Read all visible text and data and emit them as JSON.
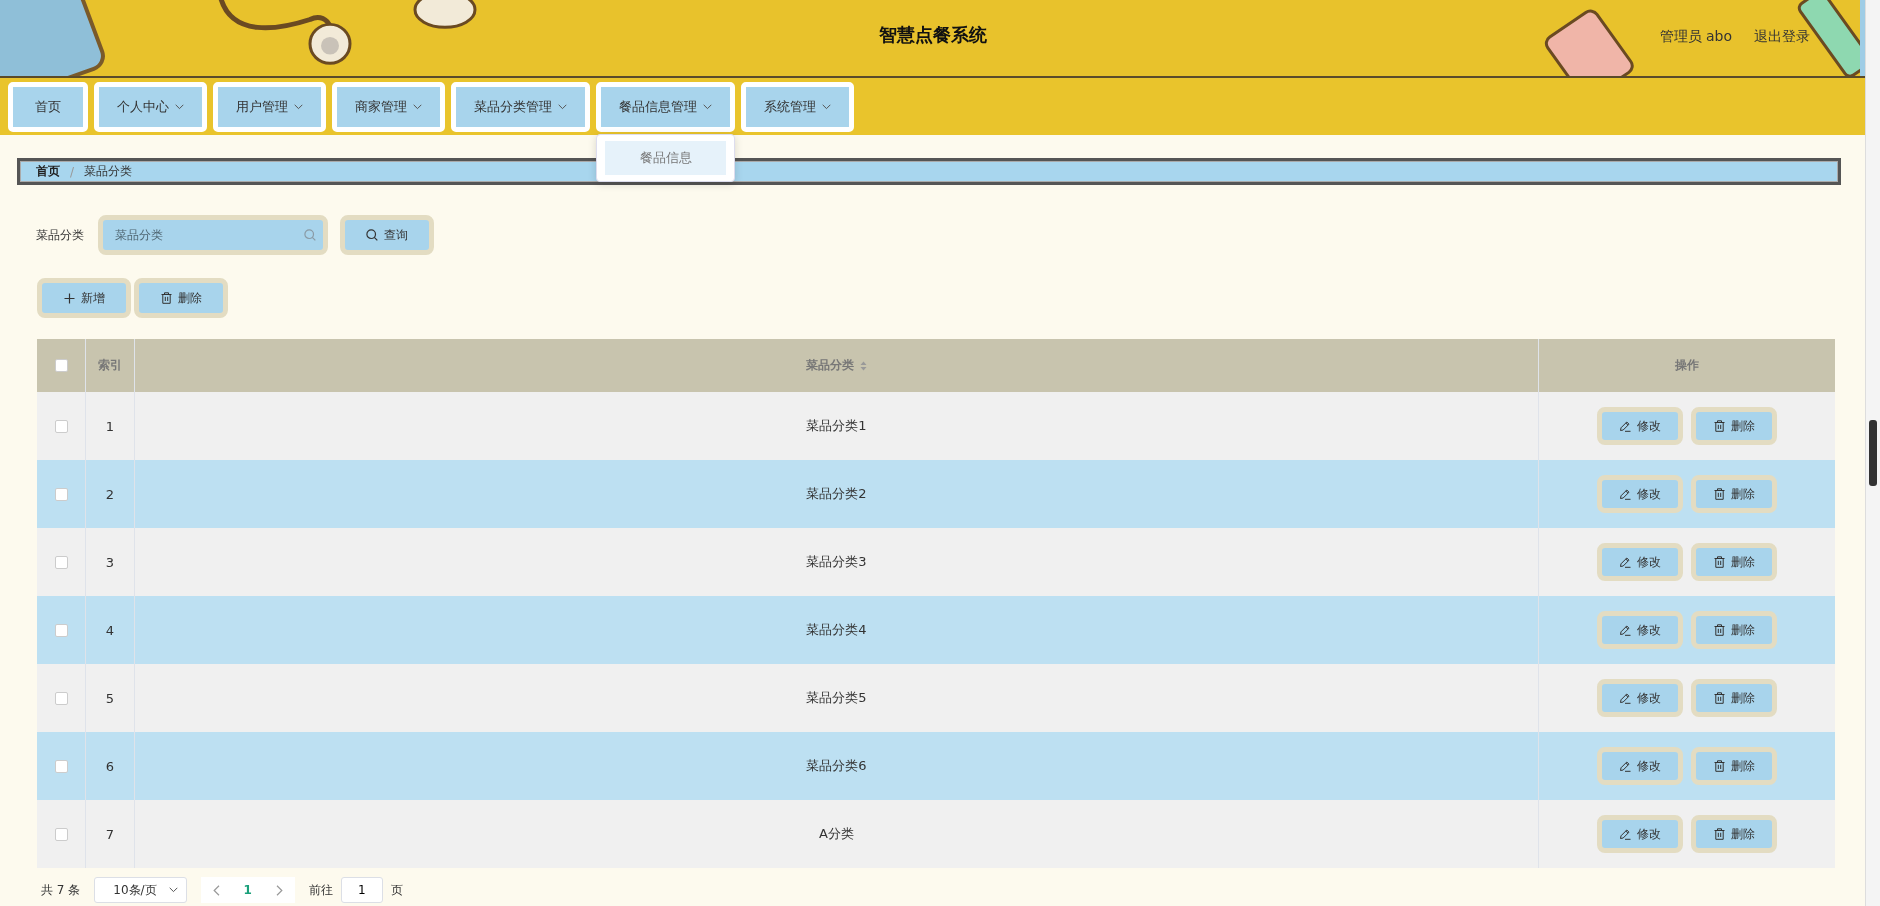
{
  "header": {
    "title": "智慧点餐系统",
    "user": "管理员 abo",
    "logout": "退出登录"
  },
  "nav": [
    {
      "label": "首页",
      "has_menu": false
    },
    {
      "label": "个人中心",
      "has_menu": true
    },
    {
      "label": "用户管理",
      "has_menu": true
    },
    {
      "label": "商家管理",
      "has_menu": true
    },
    {
      "label": "菜品分类管理",
      "has_menu": true
    },
    {
      "label": "餐品信息管理",
      "has_menu": true,
      "expanded": true,
      "menu": [
        {
          "label": "餐品信息",
          "hovered": true
        }
      ]
    },
    {
      "label": "系统管理",
      "has_menu": true
    }
  ],
  "breadcrumb": {
    "separator": "/",
    "items": [
      "首页",
      "菜品分类"
    ]
  },
  "search": {
    "label": "菜品分类",
    "placeholder": "菜品分类",
    "button": "查询"
  },
  "actions": [
    {
      "kind": "add",
      "label": "新增"
    },
    {
      "kind": "delete",
      "label": "删除"
    }
  ],
  "table": {
    "select_all": {
      "checked": false
    },
    "columns": [
      {
        "label": "索引",
        "sortable": false
      },
      {
        "label": "菜品分类",
        "sortable": true
      },
      {
        "label": "操作",
        "sortable": false
      }
    ],
    "rows": [
      {
        "index": "1",
        "name": "菜品分类1",
        "checked": false,
        "actions": [
          "修改",
          "删除"
        ]
      },
      {
        "index": "2",
        "name": "菜品分类2",
        "checked": false,
        "actions": [
          "修改",
          "删除"
        ]
      },
      {
        "index": "3",
        "name": "菜品分类3",
        "checked": false,
        "actions": [
          "修改",
          "删除"
        ]
      },
      {
        "index": "4",
        "name": "菜品分类4",
        "checked": false,
        "actions": [
          "修改",
          "删除"
        ]
      },
      {
        "index": "5",
        "name": "菜品分类5",
        "checked": false,
        "actions": [
          "修改",
          "删除"
        ]
      },
      {
        "index": "6",
        "name": "菜品分类6",
        "checked": false,
        "actions": [
          "修改",
          "删除"
        ]
      },
      {
        "index": "7",
        "name": "A分类",
        "checked": false,
        "actions": [
          "修改",
          "删除"
        ]
      }
    ]
  },
  "pagination": {
    "total": "共 7 条",
    "page_size": "10条/页",
    "pages": [
      {
        "label": "1",
        "selected": true
      }
    ],
    "goto_label": "前往",
    "goto_value": "1",
    "goto_suffix": "页"
  }
}
